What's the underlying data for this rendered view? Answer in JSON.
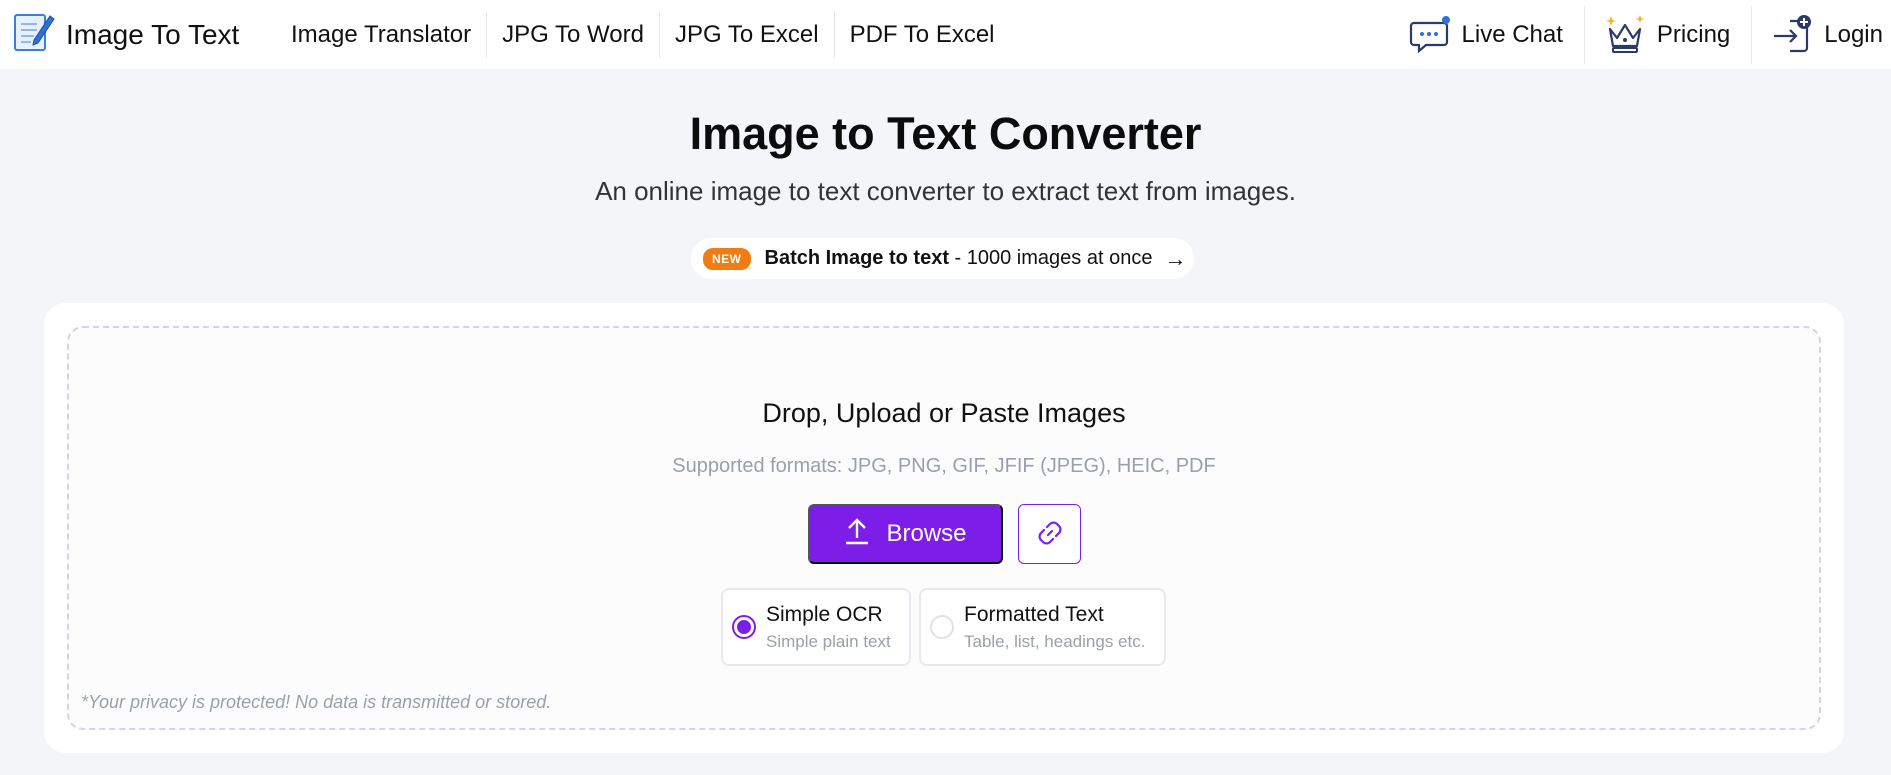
{
  "header": {
    "logo_text": "Image To Text",
    "nav": [
      {
        "label": "Image Translator"
      },
      {
        "label": "JPG To Word"
      },
      {
        "label": "JPG To Excel"
      },
      {
        "label": "PDF To Excel"
      }
    ],
    "right": {
      "live_chat": "Live Chat",
      "pricing": "Pricing",
      "login": "Login"
    }
  },
  "hero": {
    "title": "Image to Text Converter",
    "subtitle": "An online image to text converter to extract text from images.",
    "batch_badge": "NEW",
    "batch_bold": "Batch Image to text",
    "batch_rest": " - 1000 images at once",
    "batch_arrow": "→"
  },
  "upload": {
    "title": "Drop, Upload or Paste Images",
    "formats": "Supported formats: JPG, PNG, GIF, JFIF (JPEG), HEIC, PDF",
    "browse_label": "Browse",
    "options": [
      {
        "label": "Simple OCR",
        "desc": "Simple plain text",
        "checked": true
      },
      {
        "label": "Formatted Text",
        "desc": "Table, list, headings etc.",
        "checked": false
      }
    ],
    "privacy": "*Your privacy is protected! No data is transmitted or stored."
  },
  "colors": {
    "accent": "#7c1ee8",
    "badge": "#f07c12",
    "background": "#f4f5f8"
  },
  "icons": {
    "logo": "notepad-pencil-icon",
    "live_chat": "chat-bubble-icon",
    "pricing": "crown-icon",
    "login": "login-icon",
    "browse": "upload-icon",
    "link": "link-icon"
  }
}
